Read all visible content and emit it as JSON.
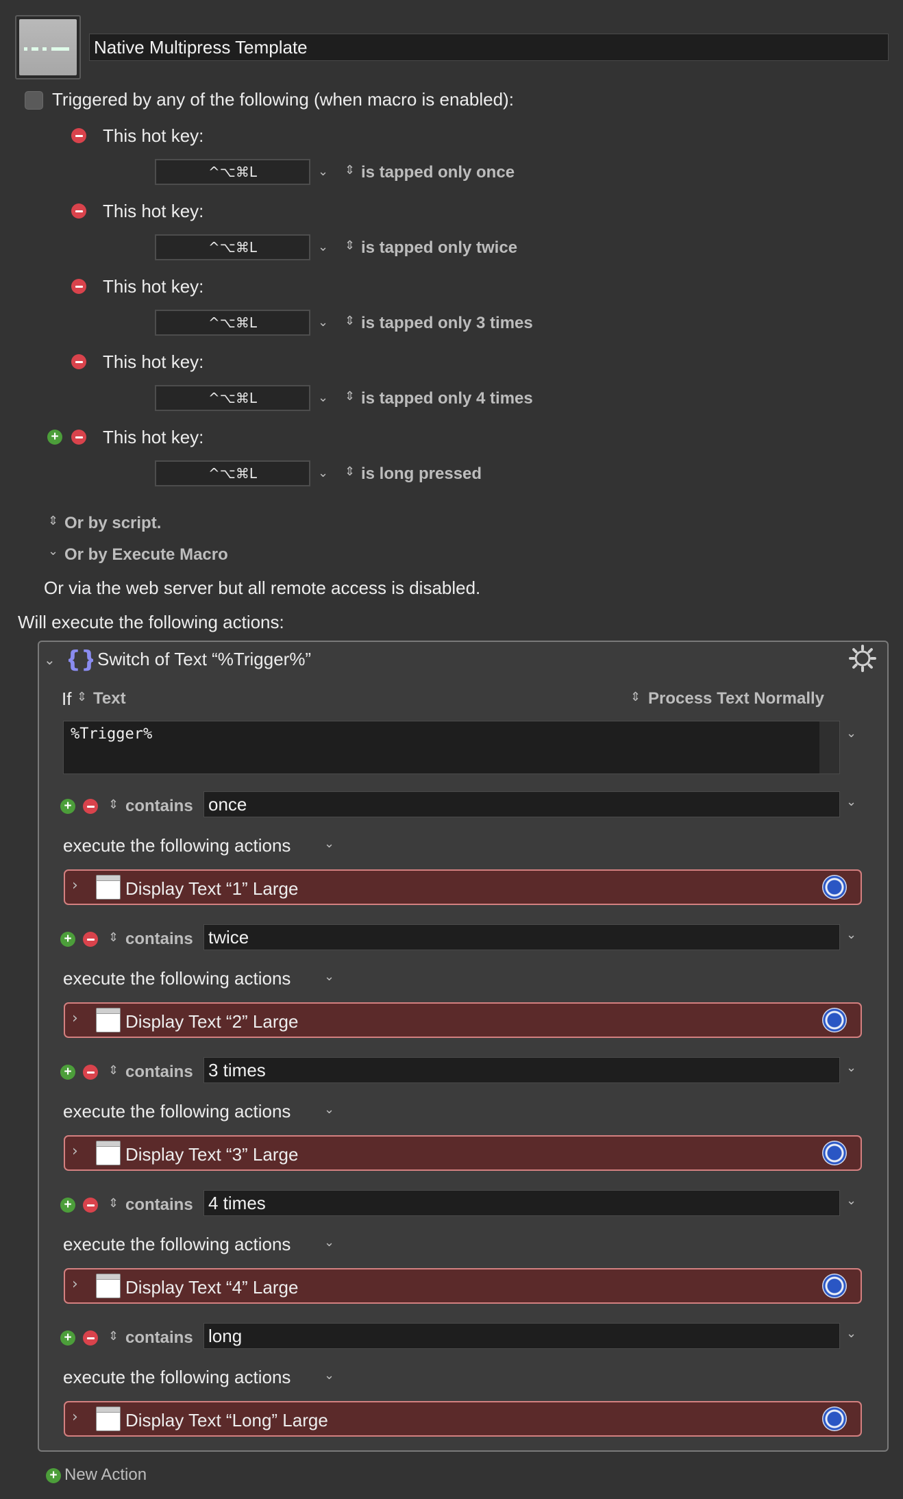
{
  "macro": {
    "name": "Native Multipress Template"
  },
  "trigger": {
    "header": "Triggered by any of the following (when macro is enabled):",
    "hotkeys": [
      {
        "label": "This hot key:",
        "keys": "^⌥⌘L",
        "mode": "is tapped only once"
      },
      {
        "label": "This hot key:",
        "keys": "^⌥⌘L",
        "mode": "is tapped only twice"
      },
      {
        "label": "This hot key:",
        "keys": "^⌥⌘L",
        "mode": "is tapped only 3 times"
      },
      {
        "label": "This hot key:",
        "keys": "^⌥⌘L",
        "mode": "is tapped only 4 times"
      },
      {
        "label": "This hot key:",
        "keys": "^⌥⌘L",
        "mode": "is long pressed"
      }
    ],
    "or_by_script": "Or by script.",
    "or_by_execute": "Or by Execute Macro",
    "web_server": "Or via the web server but all remote access is disabled."
  },
  "actions_header": "Will execute the following actions:",
  "switch_action": {
    "title": "Switch of Text “%Trigger%”",
    "if_label": "If",
    "source": "Text",
    "process": "Process Text Normally",
    "text_value": "%Trigger%",
    "cases": [
      {
        "op": "contains",
        "value": "once",
        "exec_label": "execute the following actions",
        "sub_action": "Display Text “1” Large"
      },
      {
        "op": "contains",
        "value": "twice",
        "exec_label": "execute the following actions",
        "sub_action": "Display Text “2” Large"
      },
      {
        "op": "contains",
        "value": "3 times",
        "exec_label": "execute the following actions",
        "sub_action": "Display Text “3” Large"
      },
      {
        "op": "contains",
        "value": "4 times",
        "exec_label": "execute the following actions",
        "sub_action": "Display Text “4” Large"
      },
      {
        "op": "contains",
        "value": "long",
        "exec_label": "execute the following actions",
        "sub_action": "Display Text “Long” Large"
      }
    ]
  },
  "new_action": "New Action",
  "icons": {
    "remove": "minus-circle-icon",
    "add": "plus-circle-icon",
    "menu": "chevron-down-icon",
    "stepper": "up-down-chevron-icon",
    "settings": "gear-icon"
  },
  "colors": {
    "background": "#333333",
    "sub_action_bg": "#5b2a2a",
    "sub_action_border": "#d48080",
    "remove": "#d9434c",
    "add": "#4c9e3a",
    "switch_icon": "#8a8cf0",
    "gear_blue": "#2a56c4"
  }
}
